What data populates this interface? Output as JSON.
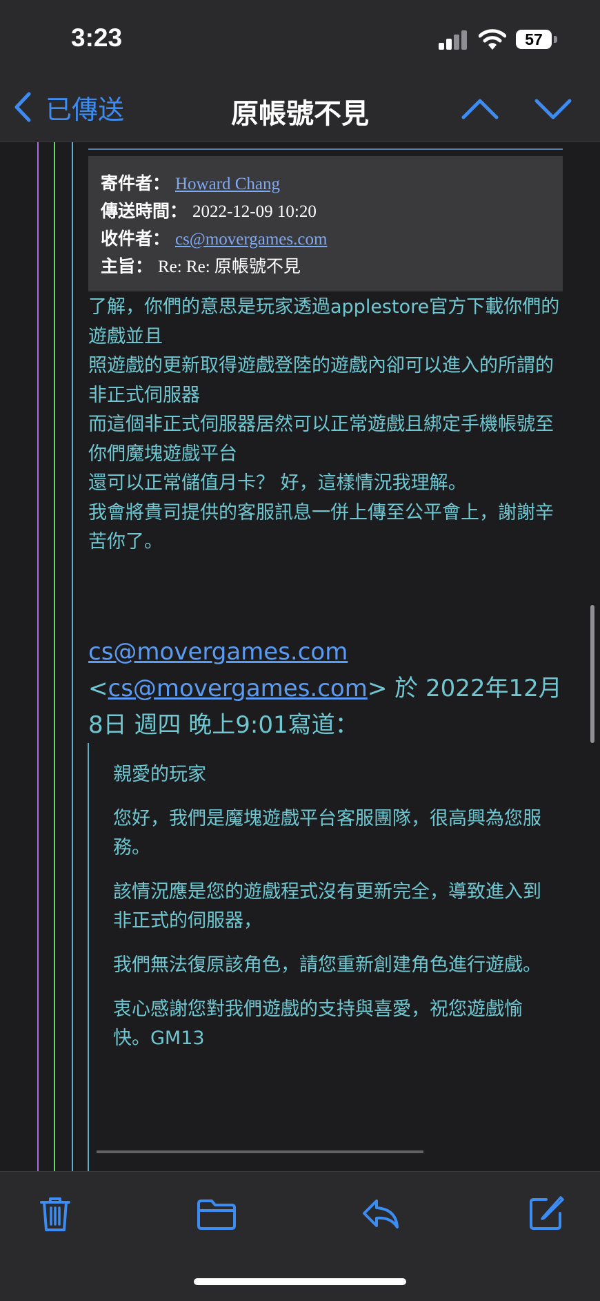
{
  "status_bar": {
    "time": "3:23",
    "battery_level": "57"
  },
  "nav": {
    "back_label": "已傳送",
    "title": "原帳號不見",
    "accent_color": "#3d8cf1"
  },
  "header": {
    "from_label": "寄件者：",
    "from_value": "Howard Chang",
    "sent_label": "傳送時間：",
    "sent_value": "2022-12-09 10:20",
    "to_label": "收件者：",
    "to_value": "cs@movergames.com",
    "subject_label": "主旨：",
    "subject_value": "Re: Re: 原帳號不見"
  },
  "reply": {
    "lines": [
      "了解，你們的意思是玩家透過applestore官方下載你們的遊戲並且",
      "照遊戲的更新取得遊戲登陸的遊戲內卻可以進入的所謂的非正式伺服器",
      "而這個非正式伺服器居然可以正常遊戲且綁定手機帳號至你們魔塊遊戲平台",
      "還可以正常儲值月卡？ 好，這樣情況我理解。",
      "我會將貴司提供的客服訊息一併上傳至公平會上，謝謝辛苦你了。"
    ]
  },
  "attribution": {
    "name_link": "cs@movergames.com",
    "open_bracket": "<",
    "email_link": "cs@movergames.com",
    "tail": "> 於 2022年12月8日 週四 晚上9:01寫道："
  },
  "quoted": {
    "paragraphs": [
      "親愛的玩家",
      "您好，我們是魔塊遊戲平台客服團隊，很高興為您服務。",
      "該情況應是您的遊戲程式沒有更新完全，導致進入到非正式的伺服器，",
      "我們無法復原該角色，請您重新創建角色進行遊戲。",
      "衷心感謝您對我們遊戲的支持與喜愛，祝您遊戲愉快。GM13"
    ]
  },
  "toolbar": {
    "icons": [
      "trash-icon",
      "folder-icon",
      "reply-icon",
      "compose-icon"
    ]
  }
}
